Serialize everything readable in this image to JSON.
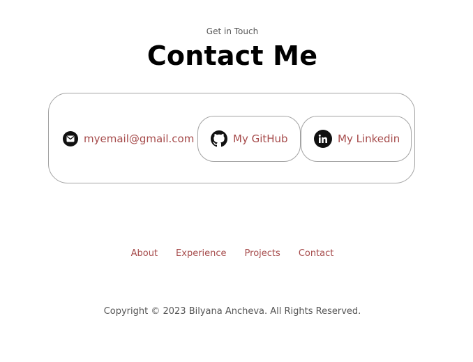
{
  "header": {
    "subtitle": "Get in Touch",
    "title": "Contact Me"
  },
  "contact": {
    "email": {
      "label": "myemail@gmail.com",
      "icon": "email-icon"
    },
    "github": {
      "label": "My GitHub",
      "icon": "github-icon"
    },
    "linkedin": {
      "label": "My Linkedin",
      "icon": "linkedin-icon"
    }
  },
  "nav": {
    "items": [
      {
        "label": "About"
      },
      {
        "label": "Experience"
      },
      {
        "label": "Projects"
      },
      {
        "label": "Contact"
      }
    ]
  },
  "footer": {
    "copyright": "Copyright © 2023 Bilyana Ancheva. All Rights Reserved."
  },
  "colors": {
    "link": "#a64b4b",
    "border": "#a3a3a3",
    "text_muted": "#555555"
  }
}
